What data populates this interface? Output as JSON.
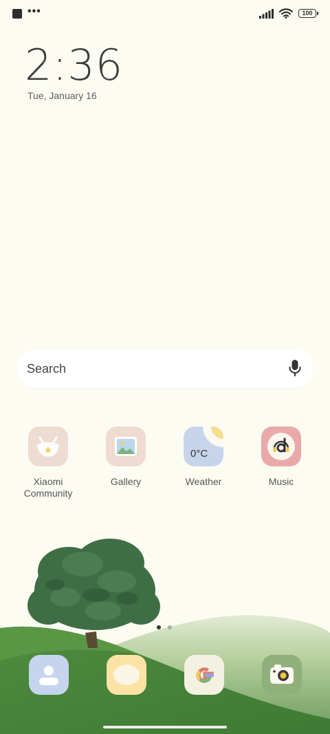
{
  "status_bar": {
    "notification_icon": "square-notification-icon",
    "more_label": "•••",
    "signal_icon": "signal-bars-icon",
    "wifi_icon": "wifi-icon",
    "battery_level": "100"
  },
  "clock": {
    "time": "2:36",
    "date": "Tue, January 16"
  },
  "search": {
    "placeholder": "Search",
    "mic_icon": "microphone-icon"
  },
  "apps": [
    {
      "label": "Xiaomi Community",
      "icon": "xiaomi-community-icon",
      "color": "#eedcd2"
    },
    {
      "label": "Gallery",
      "icon": "gallery-icon",
      "color": "#efdbd1"
    },
    {
      "label": "Weather",
      "icon": "weather-icon",
      "temp": "0°C",
      "color": "#c7d5ec"
    },
    {
      "label": "Music",
      "icon": "music-icon",
      "color": "#e9a9a8"
    }
  ],
  "dock": [
    {
      "icon": "contacts-icon",
      "color": "#c7d4ee"
    },
    {
      "icon": "messaging-icon",
      "color": "#fbe3a6"
    },
    {
      "icon": "google-icon",
      "color": "#f3f1e1"
    },
    {
      "icon": "camera-icon",
      "color": "#8fb07a"
    }
  ],
  "page_indicator": {
    "pages": 2,
    "current": 1
  }
}
